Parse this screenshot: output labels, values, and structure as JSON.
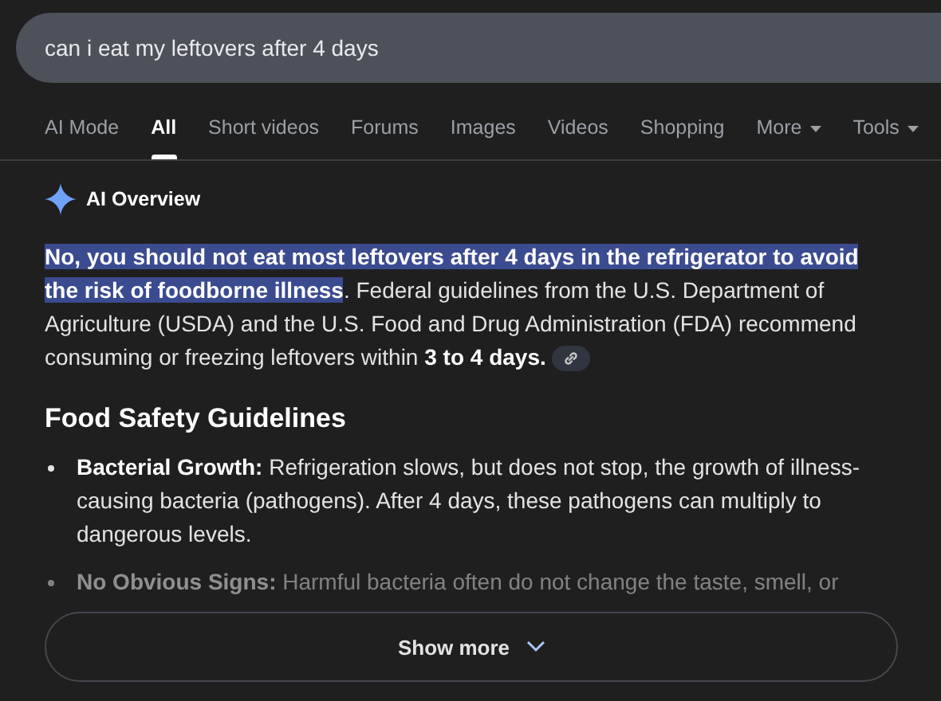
{
  "search": {
    "value": "can i eat my leftovers after 4 days"
  },
  "tabs": [
    {
      "label": "AI Mode",
      "selected": false,
      "dropdown": false
    },
    {
      "label": "All",
      "selected": true,
      "dropdown": false
    },
    {
      "label": "Short videos",
      "selected": false,
      "dropdown": false
    },
    {
      "label": "Forums",
      "selected": false,
      "dropdown": false
    },
    {
      "label": "Images",
      "selected": false,
      "dropdown": false
    },
    {
      "label": "Videos",
      "selected": false,
      "dropdown": false
    },
    {
      "label": "Shopping",
      "selected": false,
      "dropdown": false
    },
    {
      "label": "More",
      "selected": false,
      "dropdown": true
    },
    {
      "label": "Tools",
      "selected": false,
      "dropdown": true
    }
  ],
  "overview": {
    "title": "AI Overview",
    "summary": [
      {
        "kind": "highlight",
        "text": "No, you should not eat most leftovers after 4 days in the refrigerator to avoid the risk of foodborne illness"
      },
      {
        "kind": "plain",
        "text": ". Federal guidelines from the U.S. Department of Agriculture (USDA) and the U.S. Food and Drug Administration (FDA) recommend consuming or freezing leftovers within "
      },
      {
        "kind": "bold",
        "text": "3 to 4 days."
      }
    ],
    "heading": "Food Safety Guidelines",
    "bullets": [
      {
        "term": "Bacterial Growth:",
        "text": "Refrigeration slows, but does not stop, the growth of illness-causing bacteria (pathogens). After 4 days, these pathogens can multiply to dangerous levels.",
        "faded": false
      },
      {
        "term": "No Obvious Signs:",
        "text": "Harmful bacteria often do not change the taste, smell, or",
        "faded": true
      }
    ]
  },
  "show_more": {
    "label": "Show more"
  }
}
